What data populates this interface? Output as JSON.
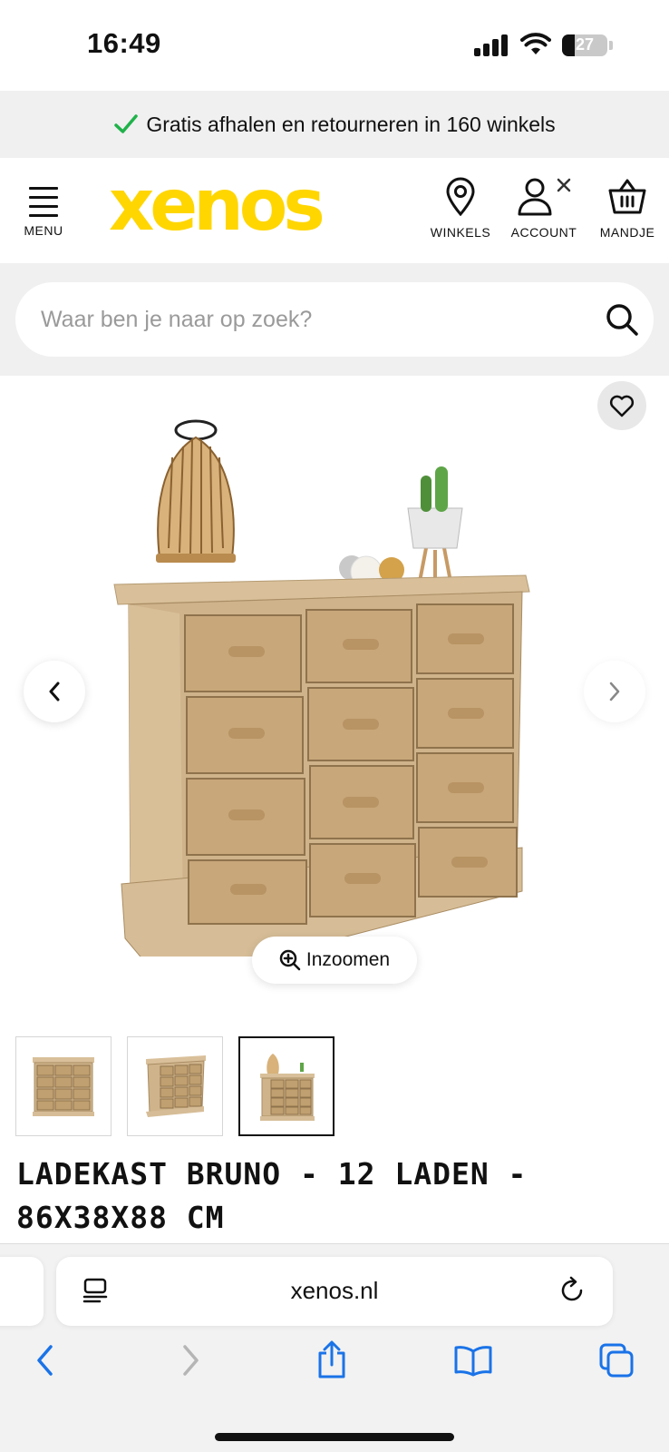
{
  "status": {
    "time": "16:49",
    "battery": "27",
    "battery_level": 0.27
  },
  "promo": {
    "text": "Gratis afhalen en retourneren in 160 winkels",
    "check_color": "#1fb24a"
  },
  "header": {
    "menu_label": "MENU",
    "logo_text": "xenos",
    "logo_color": "#ffd600",
    "winkels_label": "WINKELS",
    "account_label": "ACCOUNT",
    "mandje_label": "MANDJE"
  },
  "search": {
    "placeholder": "Waar ben je naar op zoek?",
    "value": ""
  },
  "gallery": {
    "zoom_label": "Inzoomen",
    "thumbnails": [
      "thumbnail-1",
      "thumbnail-2",
      "thumbnail-3"
    ],
    "active_thumbnail": 3
  },
  "product": {
    "title": "LADEKAST BRUNO - 12 LADEN - 86X38X88 CM"
  },
  "browser": {
    "url": "xenos.nl"
  },
  "icons": {
    "menu": "hamburger-menu-icon",
    "winkels": "location-pin-icon",
    "account": "user-icon",
    "mandje": "basket-icon",
    "search": "search-icon",
    "favorite": "heart-icon",
    "zoom": "zoom-in-icon"
  }
}
